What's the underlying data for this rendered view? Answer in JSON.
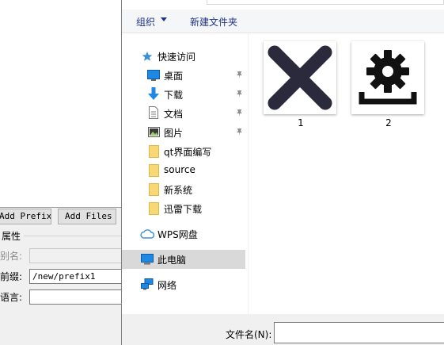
{
  "left_panel": {
    "add_prefix_label": "Add Prefix",
    "add_files_label": "Add Files",
    "properties_title": "属性",
    "alias_label": "别名:",
    "alias_value": "",
    "prefix_label": "前缀:",
    "prefix_value": "/new/prefix1",
    "language_label": "语言:",
    "language_value": ""
  },
  "dialog": {
    "toolbar": {
      "organize_label": "组织",
      "new_folder_label": "新建文件夹"
    },
    "nav": {
      "quick_access": "快速访问",
      "desktop": "桌面",
      "downloads": "下载",
      "documents": "文档",
      "pictures": "图片",
      "folders": [
        "qt界面编写",
        "source",
        "新系统",
        "迅雷下载"
      ],
      "wps_drive": "WPS网盘",
      "this_pc": "此电脑",
      "network": "网络"
    },
    "files": [
      {
        "name": "1",
        "icon": "close-x-icon"
      },
      {
        "name": "2",
        "icon": "gear-install-icon"
      }
    ],
    "filename_label": "文件名(N):",
    "filename_value": ""
  },
  "colors": {
    "accent_text": "#1e3287",
    "selection_bg": "#d9d9d9",
    "icon_dark": "#2a2a3c",
    "folder_yellow": "#f8d775"
  }
}
